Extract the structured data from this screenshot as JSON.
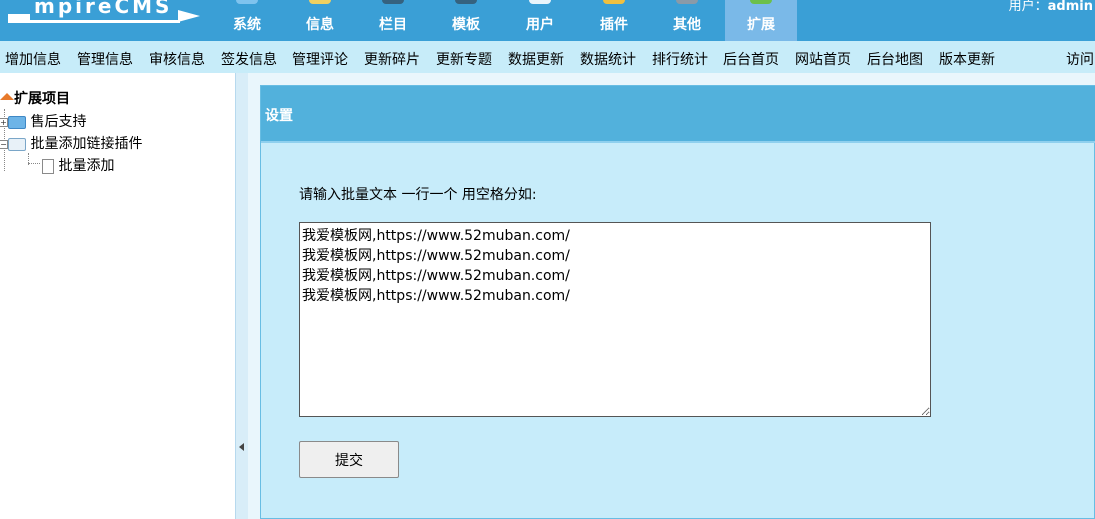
{
  "header": {
    "logo_text": "mpireCMS",
    "nav": [
      {
        "label": "系统",
        "icon": "system-icon"
      },
      {
        "label": "信息",
        "icon": "info-icon"
      },
      {
        "label": "栏目",
        "icon": "column-icon"
      },
      {
        "label": "模板",
        "icon": "template-icon"
      },
      {
        "label": "用户",
        "icon": "user-icon"
      },
      {
        "label": "插件",
        "icon": "plugin-icon"
      },
      {
        "label": "其他",
        "icon": "other-icon"
      },
      {
        "label": "扩展",
        "icon": "extend-icon",
        "active": true
      }
    ],
    "user_label": "用户：",
    "user_name": "admin"
  },
  "submenu": {
    "items": [
      "增加信息",
      "管理信息",
      "审核信息",
      "签发信息",
      "管理评论",
      "更新碎片",
      "更新专题",
      "数据更新",
      "数据统计",
      "排行统计",
      "后台首页",
      "网站首页",
      "后台地图",
      "版本更新"
    ],
    "right_item": "访问"
  },
  "tree": {
    "root": "扩展项目",
    "nodes": [
      {
        "label": "售后支持"
      },
      {
        "label": "批量添加链接插件"
      }
    ],
    "leaf": "批量添加"
  },
  "panel": {
    "title": "设置",
    "instruction": "请输入批量文本 一行一个 用空格分如:",
    "textarea_value": "我爱模板网,https://www.52muban.com/\n我爱模板网,https://www.52muban.com/\n我爱模板网,https://www.52muban.com/\n我爱模板网,https://www.52muban.com/",
    "submit_label": "提交"
  },
  "colors": {
    "header_bg": "#3a9fd6",
    "submenu_bg": "#c7ecf9",
    "panel_bg": "#c7ecfa",
    "panel_head_bg": "#52b1dc"
  }
}
